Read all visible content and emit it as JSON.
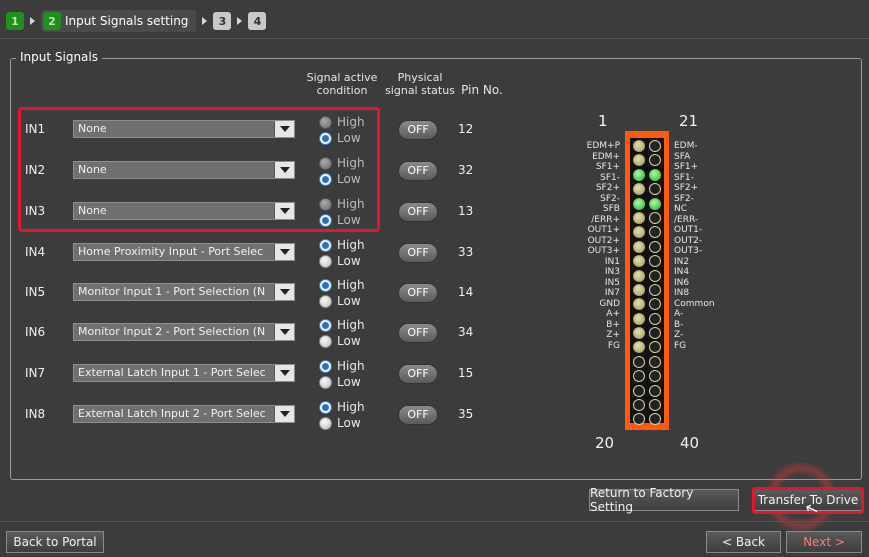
{
  "wizard": {
    "steps": [
      {
        "num": "1",
        "state": "done"
      },
      {
        "num": "2",
        "state": "active",
        "label": "Input Signals setting"
      },
      {
        "num": "3",
        "state": "todo"
      },
      {
        "num": "4",
        "state": "todo"
      }
    ]
  },
  "group": {
    "title": "Input Signals",
    "headers": {
      "signal_active": [
        "Signal active",
        "condition"
      ],
      "physical": [
        "Physical",
        "signal status"
      ],
      "pin": "Pin No."
    },
    "rows": [
      {
        "label": "IN1",
        "value": "None",
        "high": "High",
        "low": "Low",
        "selected": "low",
        "enabled": false,
        "status": "OFF",
        "pin": "12"
      },
      {
        "label": "IN2",
        "value": "None",
        "high": "High",
        "low": "Low",
        "selected": "low",
        "enabled": false,
        "status": "OFF",
        "pin": "32"
      },
      {
        "label": "IN3",
        "value": "None",
        "high": "High",
        "low": "Low",
        "selected": "low",
        "enabled": false,
        "status": "OFF",
        "pin": "13"
      },
      {
        "label": "IN4",
        "value": "Home Proximity Input - Port Selec",
        "high": "High",
        "low": "Low",
        "selected": "high",
        "enabled": true,
        "status": "OFF",
        "pin": "33"
      },
      {
        "label": "IN5",
        "value": "Monitor Input 1 - Port Selection (N",
        "high": "High",
        "low": "Low",
        "selected": "high",
        "enabled": true,
        "status": "OFF",
        "pin": "14"
      },
      {
        "label": "IN6",
        "value": "Monitor Input 2 - Port Selection (N",
        "high": "High",
        "low": "Low",
        "selected": "high",
        "enabled": true,
        "status": "OFF",
        "pin": "34"
      },
      {
        "label": "IN7",
        "value": "External Latch Input 1 - Port Selec",
        "high": "High",
        "low": "Low",
        "selected": "high",
        "enabled": true,
        "status": "OFF",
        "pin": "15"
      },
      {
        "label": "IN8",
        "value": "External Latch Input 2 - Port Selec",
        "high": "High",
        "low": "Low",
        "selected": "high",
        "enabled": true,
        "status": "OFF",
        "pin": "35"
      }
    ]
  },
  "connector": {
    "top_left": "1",
    "top_right": "21",
    "bottom_left": "20",
    "bottom_right": "40",
    "left_labels": [
      "EDM+P",
      "EDM+",
      "SF1+",
      "SF1-",
      "SF2+",
      "SF2-",
      "SFB",
      "/ERR+",
      "OUT1+",
      "OUT2+",
      "OUT3+",
      "IN1",
      "IN3",
      "IN5",
      "IN7",
      "GND",
      "A+",
      "B+",
      "Z+",
      "FG"
    ],
    "right_labels": [
      "EDM-",
      "SFA",
      "SF1+",
      "SF1-",
      "SF2+",
      "SF2-",
      "NC",
      "/ERR-",
      "OUT1-",
      "OUT2-",
      "OUT3-",
      "IN2",
      "IN4",
      "IN6",
      "IN8",
      "Common",
      "A-",
      "B-",
      "Z-",
      "FG"
    ],
    "left_pins": [
      "y",
      "y",
      "g",
      "y",
      "g",
      "y",
      "y",
      "y",
      "y",
      "y",
      "y",
      "y",
      "y",
      "y",
      "y",
      "o",
      "o",
      "o",
      "o",
      "o"
    ],
    "right_pins": [
      "o",
      "o",
      "g",
      "o",
      "g",
      "o",
      "o",
      "o",
      "o",
      "o",
      "o",
      "o",
      "o",
      "o",
      "o",
      "o",
      "o",
      "o",
      "o",
      "o"
    ]
  },
  "buttons": {
    "factory": "Return to Factory Setting",
    "transfer": "Transfer To Drive",
    "back_portal": "Back to Portal",
    "back": "< Back",
    "next": "Next >"
  },
  "colors": {
    "accent_red": "#e0172e",
    "step_green": "#1f8f1f",
    "connector_orange": "#ff5a12"
  }
}
